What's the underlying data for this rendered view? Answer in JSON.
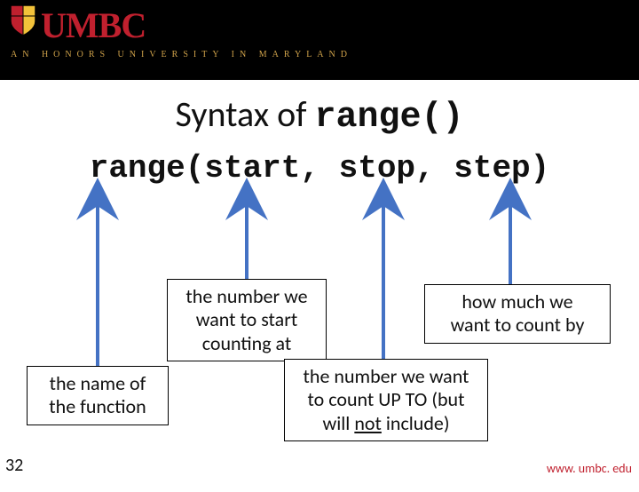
{
  "header": {
    "logo_text": "UMBC",
    "tagline": "AN HONORS UNIVERSITY IN MARYLAND"
  },
  "title": {
    "pre": "Syntax of ",
    "mono": "range()"
  },
  "code": {
    "t1": "range",
    "t2": "(",
    "t3": "start",
    "t4": ", ",
    "t5": "stop",
    "t6": ", ",
    "t7": "step",
    "t8": ")"
  },
  "boxes": {
    "start_l1": "the number we",
    "start_l2": "want to start",
    "start_l3": "counting at",
    "step_l1": "how much we",
    "step_l2": "want to count by",
    "name_l1": "the name of",
    "name_l2": "the function",
    "stop_l1": "the number we want",
    "stop_l2_a": "to count UP TO (but",
    "stop_l3_a": "will ",
    "stop_l3_b": "not",
    "stop_l3_c": " include)"
  },
  "footer": {
    "slide_number": "32",
    "url": "www. umbc. edu"
  },
  "colors": {
    "arrow": "#4472c4"
  }
}
